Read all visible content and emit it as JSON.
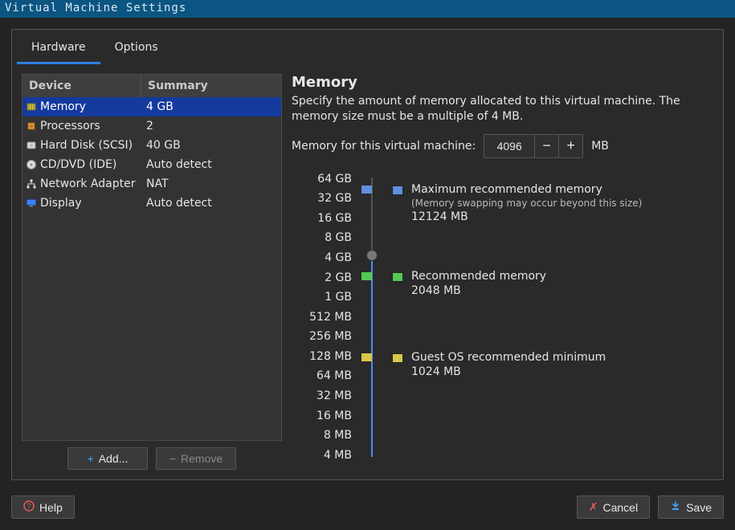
{
  "window": {
    "title": "Virtual Machine Settings"
  },
  "tabs": {
    "hardware": "Hardware",
    "options": "Options",
    "active": "hardware"
  },
  "device_table": {
    "headers": {
      "device": "Device",
      "summary": "Summary"
    },
    "rows": [
      {
        "icon": "memory-chip-icon",
        "name": "Memory",
        "summary": "4 GB",
        "selected": true
      },
      {
        "icon": "processor-icon",
        "name": "Processors",
        "summary": "2",
        "selected": false
      },
      {
        "icon": "hard-disk-icon",
        "name": "Hard Disk (SCSI)",
        "summary": "40 GB",
        "selected": false
      },
      {
        "icon": "optical-disc-icon",
        "name": "CD/DVD (IDE)",
        "summary": "Auto detect",
        "selected": false
      },
      {
        "icon": "network-icon",
        "name": "Network Adapter",
        "summary": "NAT",
        "selected": false
      },
      {
        "icon": "display-icon",
        "name": "Display",
        "summary": "Auto detect",
        "selected": false
      }
    ]
  },
  "device_buttons": {
    "add": "Add...",
    "remove": "Remove"
  },
  "memory_panel": {
    "title": "Memory",
    "description": "Specify the amount of memory allocated to this virtual machine. The memory size must be a multiple of 4 MB.",
    "field_label": "Memory for this virtual machine:",
    "value": "4096",
    "unit": "MB",
    "ticks": [
      "64 GB",
      "32 GB",
      "16 GB",
      "8 GB",
      "4 GB",
      "2 GB",
      "1 GB",
      "512 MB",
      "256 MB",
      "128 MB",
      "64 MB",
      "32 MB",
      "16 MB",
      "8 MB",
      "4 MB"
    ],
    "current_index": 4,
    "markers": {
      "max": {
        "color": "#5f8fe0",
        "title": "Maximum recommended memory",
        "sub": "(Memory swapping may occur beyond this size)",
        "value": "12124 MB",
        "pos_pct": 6
      },
      "recom": {
        "color": "#54c754",
        "title": "Recommended memory",
        "value": "2048 MB",
        "pos_pct": 36
      },
      "guestmin": {
        "color": "#d8c84a",
        "title": "Guest OS recommended minimum",
        "value": "1024 MB",
        "pos_pct": 64
      }
    }
  },
  "footer": {
    "help": "Help",
    "cancel": "Cancel",
    "save": "Save"
  }
}
